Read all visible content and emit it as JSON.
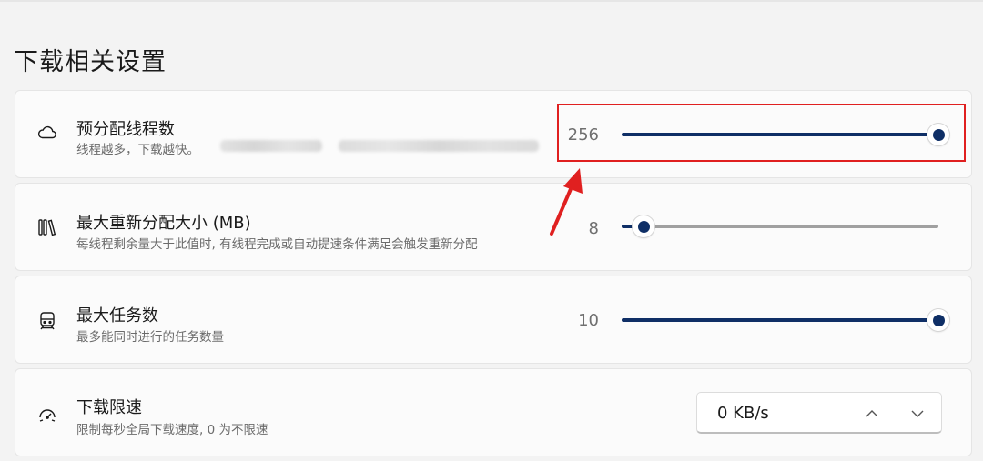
{
  "section_title": "下载相关设置",
  "settings": [
    {
      "icon": "cloud-icon",
      "title": "预分配线程数",
      "description": "线程越多，下载越快。",
      "value_text": "256",
      "slider_fraction": 1.0
    },
    {
      "icon": "books-icon",
      "title": "最大重新分配大小 (MB)",
      "description": "每线程剩余量大于此值时, 有线程完成或自动提速条件满足会触发重新分配",
      "value_text": "8",
      "slider_fraction": 0.07
    },
    {
      "icon": "train-icon",
      "title": "最大任务数",
      "description": "最多能同时进行的任务数量",
      "value_text": "10",
      "slider_fraction": 1.0
    },
    {
      "icon": "speedometer-icon",
      "title": "下载限速",
      "description": "限制每秒全局下载速度, 0 为不限速",
      "stepper_value": "0 KB/s"
    }
  ],
  "colors": {
    "accent": "#0f2f66",
    "track_inactive": "#a0a0a0",
    "annotation_red": "#e02020"
  }
}
